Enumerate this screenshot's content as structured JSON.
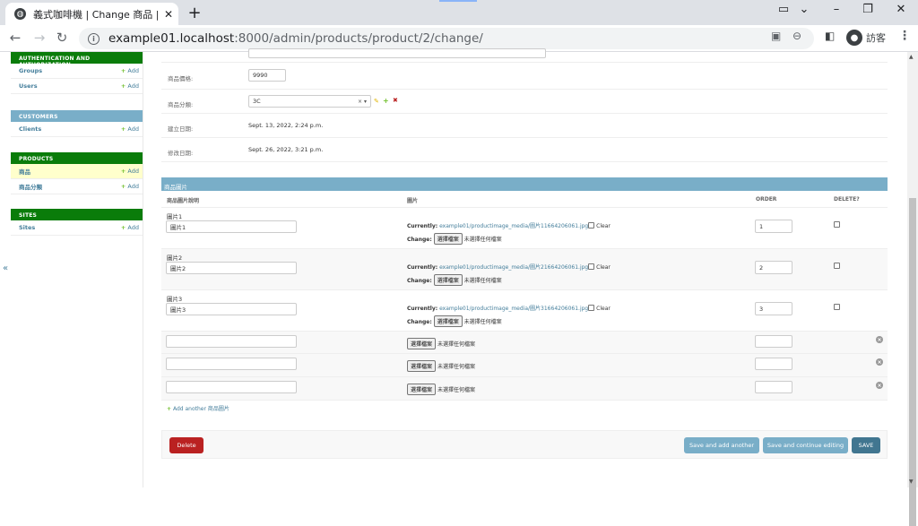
{
  "browser": {
    "tab_title": "義式咖啡機 | Change 商品 | Djan",
    "url_host": "example01.localhost",
    "url_path": ":8000/admin/products/product/2/change/",
    "profile_label": "訪客"
  },
  "sidebar": {
    "modules": [
      {
        "caption": "AUTHENTICATION AND AUTHORIZATION",
        "color": "#0a7c0a",
        "rows": [
          {
            "label": "Groups",
            "add": "Add"
          },
          {
            "label": "Users",
            "add": "Add"
          }
        ]
      },
      {
        "caption": "CUSTOMERS",
        "color": "#79aec8",
        "rows": [
          {
            "label": "Clients",
            "add": "Add"
          }
        ]
      },
      {
        "caption": "PRODUCTS",
        "color": "#0a7c0a",
        "rows": [
          {
            "label": "商品",
            "add": "Add"
          },
          {
            "label": "商品分類",
            "add": "Add"
          }
        ]
      },
      {
        "caption": "SITES",
        "color": "#0a7c0a",
        "rows": [
          {
            "label": "Sites",
            "add": "Add"
          }
        ]
      }
    ],
    "collapse_glyph": "«"
  },
  "form": {
    "price_label": "商品價格:",
    "price_value": "9990",
    "category_label": "商品分類:",
    "category_value": "3C",
    "created_label": "建立日期:",
    "created_value": "Sept. 13, 2022, 2:24 p.m.",
    "modified_label": "修改日期:",
    "modified_value": "Sept. 26, 2022, 3:21 p.m."
  },
  "inline": {
    "caption": "商品圖片",
    "headers": {
      "desc": "商品圖片說明",
      "image": "圖片",
      "order": "ORDER",
      "delete": "DELETE?"
    },
    "currently_label": "Currently:",
    "change_label": "Change:",
    "clear_label": "Clear",
    "choose_file": "選擇檔案",
    "no_file": "未選擇任何檔案",
    "rows": [
      {
        "title": "圖片1",
        "desc": "圖片1",
        "file": "example01/productimage_media/圖片11664206061.jpg",
        "order": "1"
      },
      {
        "title": "圖片2",
        "desc": "圖片2",
        "file": "example01/productimage_media/圖片21664206061.jpg",
        "order": "2"
      },
      {
        "title": "圖片3",
        "desc": "圖片3",
        "file": "example01/productimage_media/圖片31664206061.jpg",
        "order": "3"
      }
    ],
    "add_another": "Add another 商品圖片"
  },
  "actions": {
    "delete": "Delete",
    "save_add_another": "Save and add another",
    "save_continue": "Save and continue editing",
    "save": "SAVE"
  }
}
